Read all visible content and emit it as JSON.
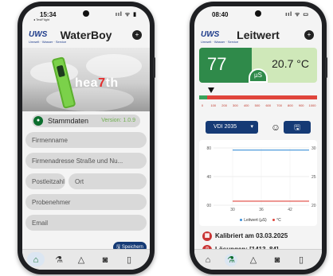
{
  "left_phone": {
    "status": {
      "time": "15:34",
      "sub": "◂ TestFlight",
      "icons": "ııl ᯤ ▮"
    },
    "header": {
      "logo": "UWS",
      "logo_sub": "Umwelt · Wasser · Service",
      "title": "WaterBoy"
    },
    "hero": {
      "brand_a": "hea",
      "brand_b": "7",
      "brand_c": "th"
    },
    "section": {
      "label": "Stammdaten",
      "version": "Version: 1.0.9"
    },
    "fields": [
      {
        "placeholder": "Firmenname"
      },
      {
        "placeholder": "Firmenadresse Straße und Nu..."
      },
      {
        "placeholder": "Postleitzahl"
      },
      {
        "placeholder": "Ort"
      },
      {
        "placeholder": "Probenehmer"
      },
      {
        "placeholder": "Email"
      }
    ],
    "save_label": "Speichern",
    "tabs": [
      "home-icon",
      "flask-icon",
      "flask-alt-icon",
      "camera-icon",
      "document-icon"
    ]
  },
  "right_phone": {
    "status": {
      "time": "08:40",
      "icons": "ııl ᯤ ▭"
    },
    "header": {
      "logo": "UWS",
      "logo_sub": "Umwelt · Wasser · Service",
      "title": "Leitwert"
    },
    "meter": {
      "value": "77",
      "unit": "µS",
      "temperature": "20.7 °C"
    },
    "scale_ticks": [
      "0",
      "100",
      "200",
      "300",
      "400",
      "500",
      "600",
      "700",
      "800",
      "900",
      "1000"
    ],
    "select": {
      "value": "VDI 2035"
    },
    "info": [
      {
        "icon": "calendar-icon",
        "text": "Kalibriert am 03.03.2025"
      },
      {
        "icon": "test-tube-icon",
        "text": "Lösungen: [1413, 84]"
      }
    ],
    "colors": {
      "green": "#2f8a4a",
      "navy": "#153a75",
      "red": "#e0453c"
    }
  },
  "chart_data": {
    "type": "line",
    "x": [
      30,
      36,
      42
    ],
    "xticks": [
      "30",
      "36",
      "42"
    ],
    "ylim_left": [
      0,
      80
    ],
    "yticks_left": [
      "80",
      "40",
      "00"
    ],
    "ylim_right": [
      20,
      30
    ],
    "yticks_right": [
      "30",
      "25",
      "20"
    ],
    "series": [
      {
        "name": "Leitwert (µS)",
        "color": "#3a8fd8",
        "x": [
          30,
          36,
          42,
          46
        ],
        "values": [
          77,
          77,
          77,
          77
        ]
      },
      {
        "name": "°C",
        "color": "#e0453c",
        "x": [
          30,
          36,
          42,
          46
        ],
        "values": [
          20.7,
          20.7,
          20.7,
          20.7
        ]
      }
    ],
    "grid": true,
    "legend": "bottom"
  }
}
